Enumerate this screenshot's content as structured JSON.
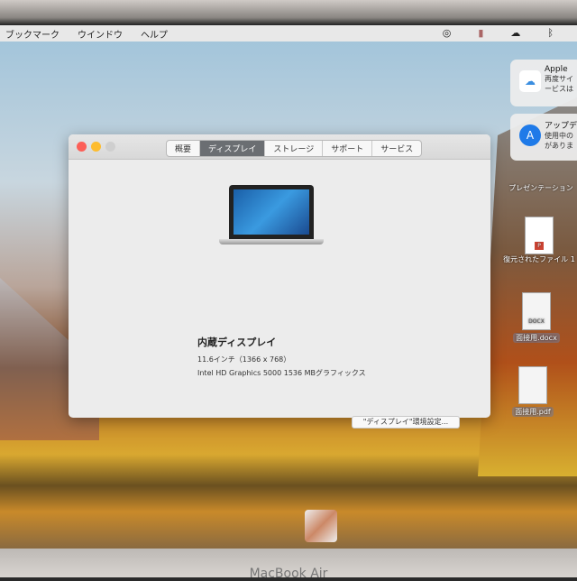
{
  "menubar": {
    "items": [
      "ブックマーク",
      "ウインドウ",
      "ヘルプ"
    ],
    "status_icons": [
      "creative-cloud-icon",
      "app-icon",
      "cloud-upload-icon",
      "bluetooth-icon"
    ]
  },
  "window": {
    "tabs": [
      {
        "label": "概要",
        "active": false
      },
      {
        "label": "ディスプレイ",
        "active": true
      },
      {
        "label": "ストレージ",
        "active": false
      },
      {
        "label": "サポート",
        "active": false
      },
      {
        "label": "サービス",
        "active": false
      }
    ],
    "display_title": "内蔵ディスプレイ",
    "display_size": "11.6インチ（1366 x 768）",
    "graphics": "Intel HD Graphics 5000 1536 MBグラフィックス",
    "prefs_button": "\"ディスプレイ\"環境設定..."
  },
  "notifications": [
    {
      "title": "Apple",
      "lines": [
        "再度サイ",
        "ービスは"
      ],
      "icon": "icloud-icon"
    },
    {
      "title": "アップデ",
      "lines": [
        "使用中の",
        "がありま"
      ],
      "icon": "app-store-icon"
    }
  ],
  "desktop_icons": [
    {
      "label": "プレゼンテーション"
    },
    {
      "label": "復元されたファイル 1"
    },
    {
      "label": "面接用.docx",
      "badge": "DOCX"
    },
    {
      "label": "面接用.pdf"
    }
  ],
  "bezel_label": "MacBook Air"
}
